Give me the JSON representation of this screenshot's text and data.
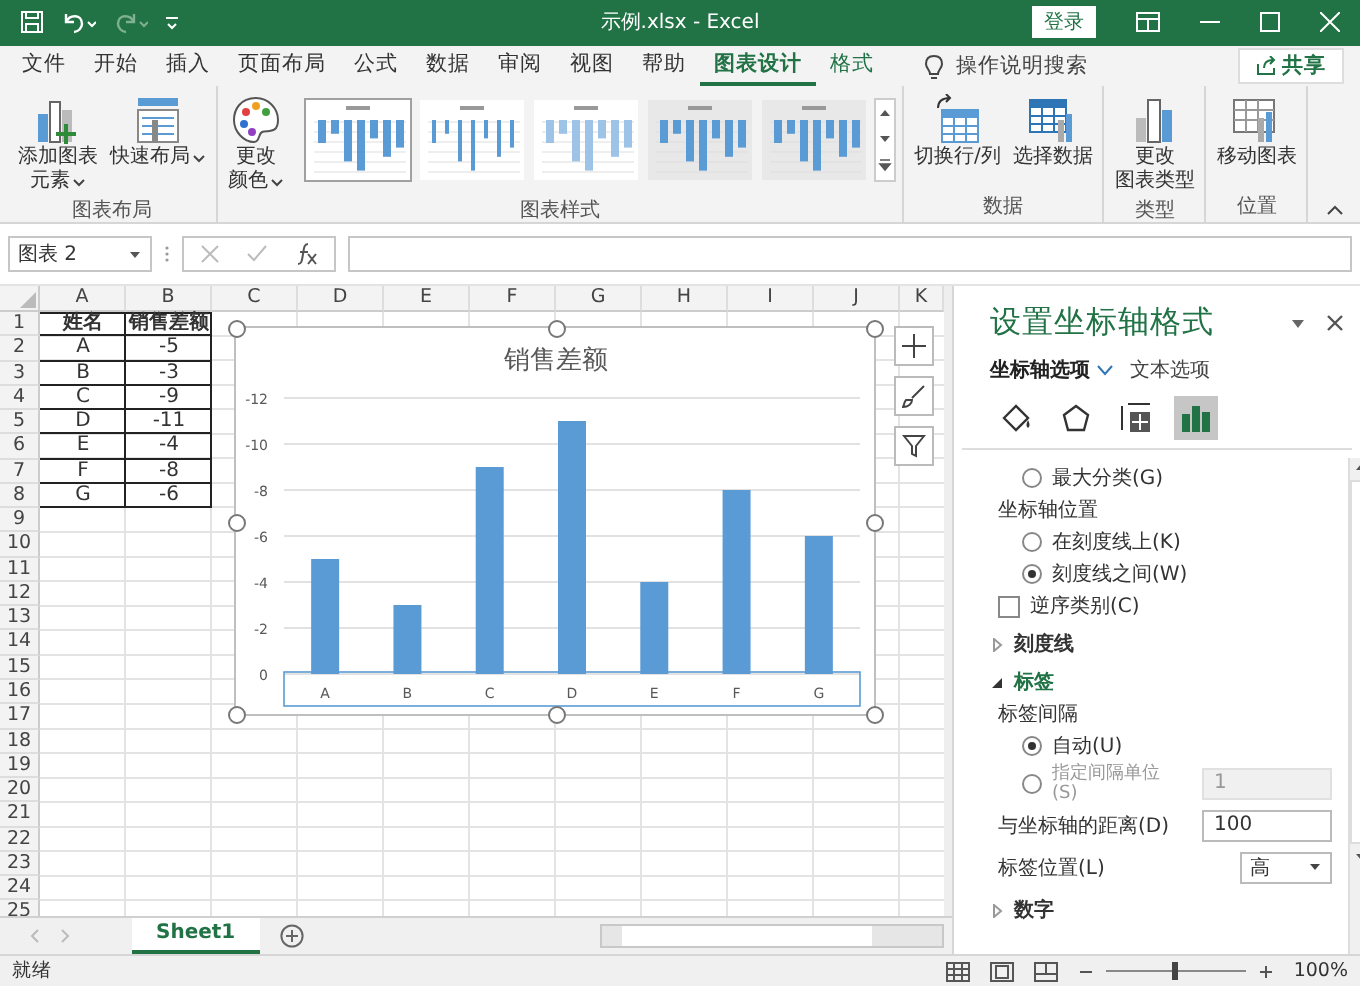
{
  "window": {
    "title": "示例.xlsx  -  Excel",
    "login_button": "登录"
  },
  "ribbon_tabs": [
    {
      "label": "文件",
      "selected": false,
      "contextual": false
    },
    {
      "label": "开始",
      "selected": false,
      "contextual": false
    },
    {
      "label": "插入",
      "selected": false,
      "contextual": false
    },
    {
      "label": "页面布局",
      "selected": false,
      "contextual": false
    },
    {
      "label": "公式",
      "selected": false,
      "contextual": false
    },
    {
      "label": "数据",
      "selected": false,
      "contextual": false
    },
    {
      "label": "审阅",
      "selected": false,
      "contextual": false
    },
    {
      "label": "视图",
      "selected": false,
      "contextual": false
    },
    {
      "label": "帮助",
      "selected": false,
      "contextual": false
    },
    {
      "label": "图表设计",
      "selected": true,
      "contextual": true
    },
    {
      "label": "格式",
      "selected": false,
      "contextual": true
    }
  ],
  "tell_me": {
    "placeholder": "操作说明搜索"
  },
  "share_button": "共享",
  "ribbon_groups": [
    {
      "label": "图表布局",
      "items": [
        {
          "kind": "button",
          "lines": [
            "添加图表",
            "元素"
          ],
          "dropdown": true
        },
        {
          "kind": "button",
          "lines": [
            "快速布局"
          ],
          "dropdown": true
        }
      ]
    },
    {
      "label": "图表样式",
      "items": [
        {
          "kind": "button",
          "lines": [
            "更改",
            "颜色"
          ],
          "dropdown": true
        },
        {
          "kind": "gallery",
          "styles": [
            {
              "selected": true
            },
            {
              "selected": false
            },
            {
              "selected": false
            },
            {
              "selected": false
            },
            {
              "selected": false
            }
          ]
        }
      ]
    },
    {
      "label": "数据",
      "items": [
        {
          "kind": "button",
          "lines": [
            "切换行/列"
          ],
          "dropdown": false
        },
        {
          "kind": "button",
          "lines": [
            "选择数据"
          ],
          "dropdown": false
        }
      ]
    },
    {
      "label": "类型",
      "items": [
        {
          "kind": "button",
          "lines": [
            "更改",
            "图表类型"
          ],
          "dropdown": false
        }
      ]
    },
    {
      "label": "位置",
      "items": [
        {
          "kind": "button",
          "lines": [
            "移动图表"
          ],
          "dropdown": false
        }
      ]
    }
  ],
  "formula_bar": {
    "name_box": "图表 2"
  },
  "sheet": {
    "columns": [
      "A",
      "B",
      "C",
      "D",
      "E",
      "F",
      "G",
      "H",
      "I",
      "J",
      "K"
    ],
    "row_numbers": [
      "1",
      "2",
      "3",
      "4",
      "5",
      "6",
      "7",
      "8",
      "9",
      "10",
      "11",
      "12",
      "13",
      "14",
      "15",
      "16",
      "17",
      "18",
      "19",
      "20",
      "21",
      "22",
      "23",
      "24",
      "25"
    ],
    "table": {
      "columns": [
        "姓名",
        "销售差额"
      ],
      "rows": [
        [
          "A",
          "-5"
        ],
        [
          "B",
          "-3"
        ],
        [
          "C",
          "-9"
        ],
        [
          "D",
          "-11"
        ],
        [
          "E",
          "-4"
        ],
        [
          "F",
          "-8"
        ],
        [
          "G",
          "-6"
        ]
      ]
    }
  },
  "chart": {
    "chart_data": {
      "type": "bar",
      "title": "销售差额",
      "categories": [
        "A",
        "B",
        "C",
        "D",
        "E",
        "F",
        "G"
      ],
      "series": [
        {
          "color": "#5b9bd5",
          "values": [
            -5,
            -3,
            -9,
            -11,
            -4,
            -8,
            -6
          ]
        }
      ],
      "grid": true,
      "ylim": [
        0,
        -12
      ],
      "yticks": [
        0,
        -2,
        -4,
        -6,
        -8,
        -10,
        -12
      ]
    }
  },
  "pane": {
    "title": "设置坐标轴格式",
    "tabs": [
      {
        "label": "坐标轴选项",
        "selected": true
      },
      {
        "label": "文本选项",
        "selected": false
      }
    ],
    "icons": [
      {
        "kind": "fill",
        "selected": false
      },
      {
        "kind": "effects",
        "selected": false
      },
      {
        "kind": "size",
        "selected": false
      },
      {
        "kind": "axis",
        "selected": true
      }
    ],
    "items": [
      {
        "kind": "radio",
        "label": "最大分类(G)",
        "checked": false
      },
      {
        "kind": "heading",
        "label": "坐标轴位置"
      },
      {
        "kind": "radio",
        "label": "在刻度线上(K)",
        "checked": false
      },
      {
        "kind": "radio",
        "label": "刻度线之间(W)",
        "checked": true
      },
      {
        "kind": "checkbox",
        "label": "逆序类别(C)",
        "checked": false
      },
      {
        "kind": "section",
        "label": "刻度线",
        "expanded": false
      },
      {
        "kind": "section",
        "label": "标签",
        "expanded": true
      },
      {
        "kind": "heading",
        "label": "标签间隔"
      },
      {
        "kind": "radio",
        "label": "自动(U)",
        "checked": true
      },
      {
        "kind": "radio_field",
        "label": "指定间隔单位(S)",
        "checked": false,
        "value": "1",
        "disabled": true
      },
      {
        "kind": "field",
        "label": "与坐标轴的距离(D)",
        "value": "100"
      },
      {
        "kind": "select",
        "label": "标签位置(L)",
        "value": "高"
      },
      {
        "kind": "section",
        "label": "数字",
        "expanded": false
      }
    ]
  },
  "sheet_tabs": [
    {
      "label": "Sheet1",
      "selected": true
    }
  ],
  "status_bar": {
    "text": "就绪",
    "zoom": {
      "level": 0.5,
      "reading": "100%"
    }
  }
}
